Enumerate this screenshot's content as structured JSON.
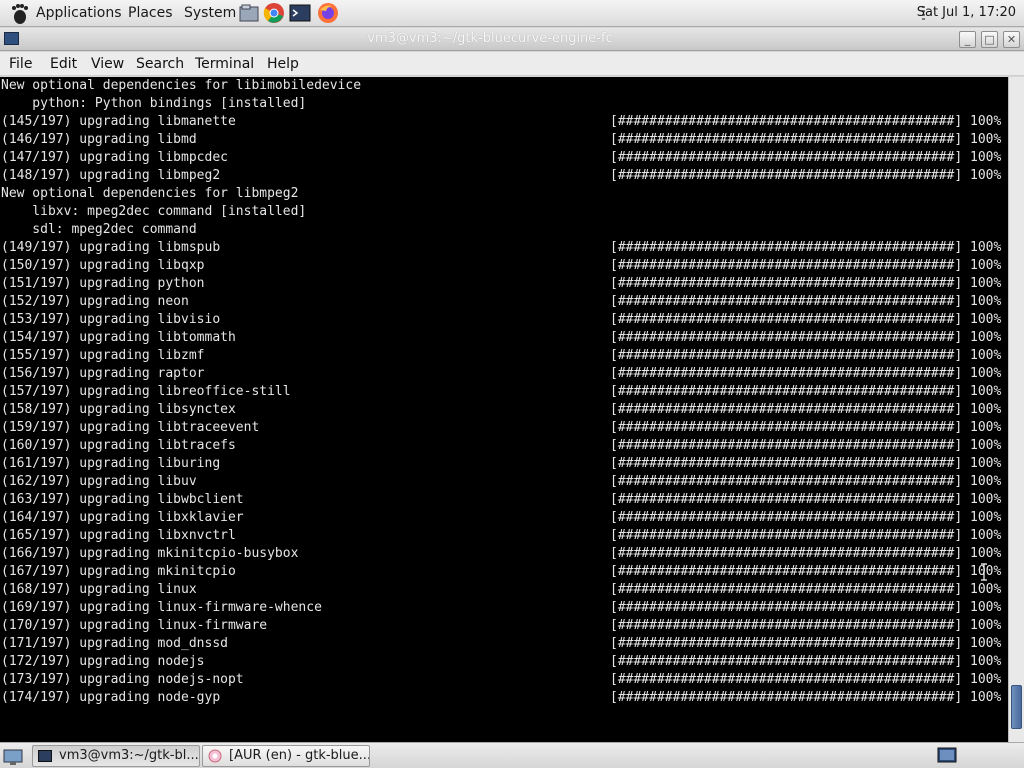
{
  "top_panel": {
    "menus": [
      "Applications",
      "Places",
      "System"
    ],
    "launchers": [
      "files-icon",
      "chrome-icon",
      "terminal-icon",
      "firefox-icon"
    ],
    "clock": "Sat Jul 1, 17:20"
  },
  "window": {
    "title": "vm3@vm3:~/gtk-bluecurve-engine-fc",
    "menubar": [
      "File",
      "Edit",
      "View",
      "Search",
      "Terminal",
      "Help"
    ]
  },
  "terminal": {
    "lines": [
      {
        "text": "New optional dependencies for libimobiledevice",
        "progress": ""
      },
      {
        "text": "    python: Python bindings [installed]",
        "progress": ""
      },
      {
        "text": "(145/197) upgrading libmanette",
        "progress": "[###########################################] 100%"
      },
      {
        "text": "(146/197) upgrading libmd",
        "progress": "[###########################################] 100%"
      },
      {
        "text": "(147/197) upgrading libmpcdec",
        "progress": "[###########################################] 100%"
      },
      {
        "text": "(148/197) upgrading libmpeg2",
        "progress": "[###########################################] 100%"
      },
      {
        "text": "New optional dependencies for libmpeg2",
        "progress": ""
      },
      {
        "text": "    libxv: mpeg2dec command [installed]",
        "progress": ""
      },
      {
        "text": "    sdl: mpeg2dec command",
        "progress": ""
      },
      {
        "text": "(149/197) upgrading libmspub",
        "progress": "[###########################################] 100%"
      },
      {
        "text": "(150/197) upgrading libqxp",
        "progress": "[###########################################] 100%"
      },
      {
        "text": "(151/197) upgrading python",
        "progress": "[###########################################] 100%"
      },
      {
        "text": "(152/197) upgrading neon",
        "progress": "[###########################################] 100%"
      },
      {
        "text": "(153/197) upgrading libvisio",
        "progress": "[###########################################] 100%"
      },
      {
        "text": "(154/197) upgrading libtommath",
        "progress": "[###########################################] 100%"
      },
      {
        "text": "(155/197) upgrading libzmf",
        "progress": "[###########################################] 100%"
      },
      {
        "text": "(156/197) upgrading raptor",
        "progress": "[###########################################] 100%"
      },
      {
        "text": "(157/197) upgrading libreoffice-still",
        "progress": "[###########################################] 100%"
      },
      {
        "text": "(158/197) upgrading libsynctex",
        "progress": "[###########################################] 100%"
      },
      {
        "text": "(159/197) upgrading libtraceevent",
        "progress": "[###########################################] 100%"
      },
      {
        "text": "(160/197) upgrading libtracefs",
        "progress": "[###########################################] 100%"
      },
      {
        "text": "(161/197) upgrading liburing",
        "progress": "[###########################################] 100%"
      },
      {
        "text": "(162/197) upgrading libuv",
        "progress": "[###########################################] 100%"
      },
      {
        "text": "(163/197) upgrading libwbclient",
        "progress": "[###########################################] 100%"
      },
      {
        "text": "(164/197) upgrading libxklavier",
        "progress": "[###########################################] 100%"
      },
      {
        "text": "(165/197) upgrading libxnvctrl",
        "progress": "[###########################################] 100%"
      },
      {
        "text": "(166/197) upgrading mkinitcpio-busybox",
        "progress": "[###########################################] 100%"
      },
      {
        "text": "(167/197) upgrading mkinitcpio",
        "progress": "[###########################################] 100%"
      },
      {
        "text": "(168/197) upgrading linux",
        "progress": "[###########################################] 100%"
      },
      {
        "text": "(169/197) upgrading linux-firmware-whence",
        "progress": "[###########################################] 100%"
      },
      {
        "text": "(170/197) upgrading linux-firmware",
        "progress": "[###########################################] 100%"
      },
      {
        "text": "(171/197) upgrading mod_dnssd",
        "progress": "[###########################################] 100%"
      },
      {
        "text": "(172/197) upgrading nodejs",
        "progress": "[###########################################] 100%"
      },
      {
        "text": "(173/197) upgrading nodejs-nopt",
        "progress": "[###########################################] 100%"
      },
      {
        "text": "(174/197) upgrading node-gyp",
        "progress": "[###########################################] 100%"
      }
    ]
  },
  "taskbar": {
    "tasks": [
      {
        "label": "vm3@vm3:~/gtk-bl...",
        "icon": "terminal-icon",
        "active": true
      },
      {
        "label": "[AUR (en) - gtk-blue...",
        "icon": "browser-icon",
        "active": false
      }
    ]
  }
}
